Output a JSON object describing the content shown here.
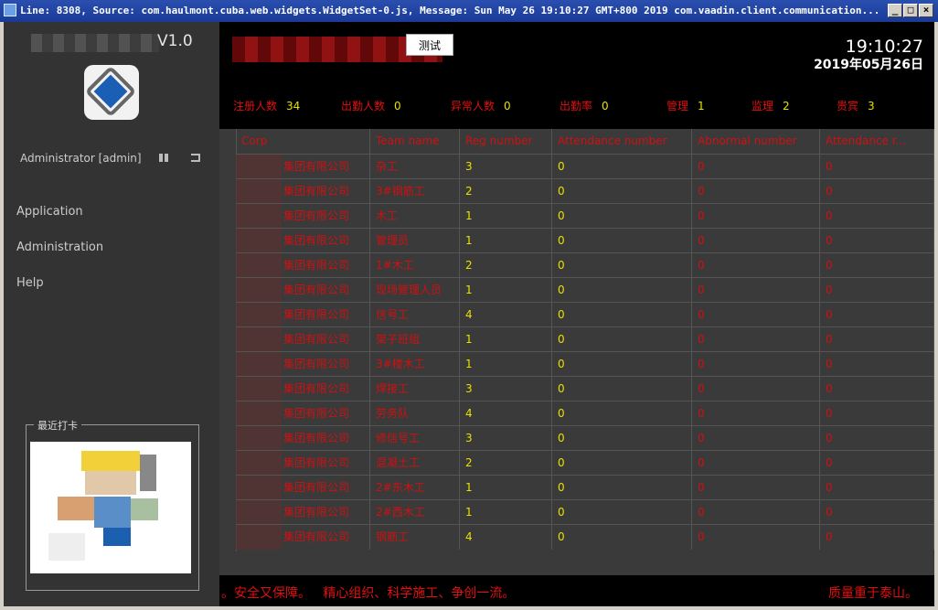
{
  "window": {
    "title": "Line: 8308, Source: com.haulmont.cuba.web.widgets.WidgetSet-0.js, Message: Sun May 26 19:10:27 GMT+800 2019 com.vaadin.client.communication...",
    "buttons": [
      "_",
      "□",
      "×"
    ]
  },
  "sidebar": {
    "app_version": "V1.0",
    "user": "Administrator [admin]",
    "menu": [
      "Application",
      "Administration",
      "Help"
    ],
    "checkin_title": "最近打卡"
  },
  "header": {
    "test_button": "测试",
    "time": "19:10:27",
    "date": "2019年05月26日"
  },
  "stats": [
    {
      "label": "注册人数",
      "value": "34"
    },
    {
      "label": "出勤人数",
      "value": "0"
    },
    {
      "label": "异常人数",
      "value": "0"
    },
    {
      "label": "出勤率",
      "value": "0"
    },
    {
      "label": "管理",
      "value": "1"
    },
    {
      "label": "监理",
      "value": "2"
    },
    {
      "label": "贵宾",
      "value": "3"
    }
  ],
  "table": {
    "columns": [
      "Corp",
      "Team name",
      "Reg number",
      "Attendance number",
      "Abnormal number",
      "Attendance r..."
    ],
    "rows": [
      {
        "corp": "集团有限公司",
        "team": "杂工",
        "reg": "3",
        "att": "0",
        "abn": "0",
        "rate": "0"
      },
      {
        "corp": "集团有限公司",
        "team": "3#钢筋工",
        "reg": "2",
        "att": "0",
        "abn": "0",
        "rate": "0"
      },
      {
        "corp": "集团有限公司",
        "team": "木工",
        "reg": "1",
        "att": "0",
        "abn": "0",
        "rate": "0"
      },
      {
        "corp": "集团有限公司",
        "team": "管理员",
        "reg": "1",
        "att": "0",
        "abn": "0",
        "rate": "0"
      },
      {
        "corp": "集团有限公司",
        "team": "1#木工",
        "reg": "2",
        "att": "0",
        "abn": "0",
        "rate": "0"
      },
      {
        "corp": "集团有限公司",
        "team": "现场管理人员",
        "reg": "1",
        "att": "0",
        "abn": "0",
        "rate": "0"
      },
      {
        "corp": "集团有限公司",
        "team": "信号工",
        "reg": "4",
        "att": "0",
        "abn": "0",
        "rate": "0"
      },
      {
        "corp": "集团有限公司",
        "team": "架子班组",
        "reg": "1",
        "att": "0",
        "abn": "0",
        "rate": "0"
      },
      {
        "corp": "集团有限公司",
        "team": "3#楼木工",
        "reg": "1",
        "att": "0",
        "abn": "0",
        "rate": "0"
      },
      {
        "corp": "集团有限公司",
        "team": "焊接工",
        "reg": "3",
        "att": "0",
        "abn": "0",
        "rate": "0"
      },
      {
        "corp": "集团有限公司",
        "team": "劳务队",
        "reg": "4",
        "att": "0",
        "abn": "0",
        "rate": "0"
      },
      {
        "corp": "集团有限公司",
        "team": "修信号工",
        "reg": "3",
        "att": "0",
        "abn": "0",
        "rate": "0"
      },
      {
        "corp": "集团有限公司",
        "team": "混凝土工",
        "reg": "2",
        "att": "0",
        "abn": "0",
        "rate": "0"
      },
      {
        "corp": "集团有限公司",
        "team": "2#东木工",
        "reg": "1",
        "att": "0",
        "abn": "0",
        "rate": "0"
      },
      {
        "corp": "集团有限公司",
        "team": "2#西木工",
        "reg": "1",
        "att": "0",
        "abn": "0",
        "rate": "0"
      },
      {
        "corp": "集团有限公司",
        "team": "钢筋工",
        "reg": "4",
        "att": "0",
        "abn": "0",
        "rate": "0"
      }
    ]
  },
  "ticker": {
    "left": "。安全又保障。   精心组织、科学施工、争创一流。",
    "right": "质量重于泰山。"
  }
}
